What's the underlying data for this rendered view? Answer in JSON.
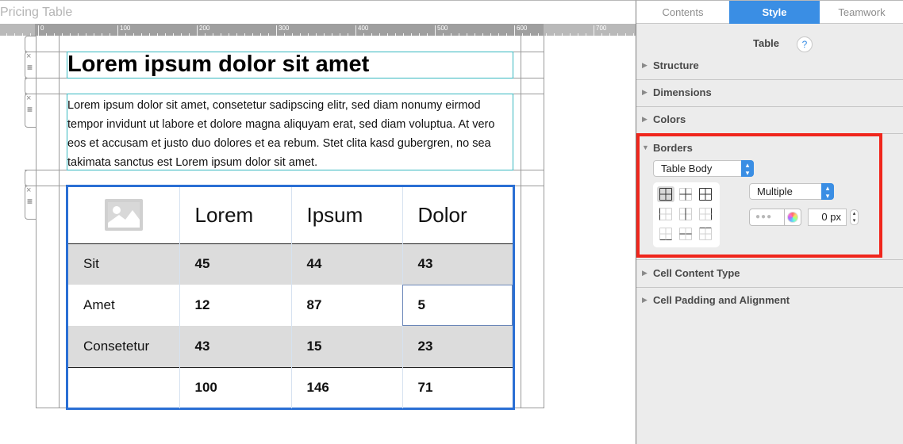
{
  "editor": {
    "page_title": "Pricing Table",
    "ruler": {
      "labels": [
        "0",
        "100",
        "200",
        "300",
        "400",
        "500",
        "600",
        "700"
      ]
    },
    "heading": "Lorem ipsum dolor sit amet",
    "paragraph": "Lorem ipsum dolor sit amet, consetetur sadipscing elitr, sed diam nonumy eirmod tempor invidunt ut labore et dolore magna aliquyam erat, sed diam voluptua. At vero eos et accusam et justo duo dolores et ea rebum. Stet clita kasd gubergren, no sea takimata sanctus est Lorem ipsum dolor sit amet.",
    "row_handle_icons": {
      "close": "×",
      "menu": "≡"
    },
    "table": {
      "header_image_icon": "image-placeholder-icon",
      "columns": [
        "Lorem",
        "Ipsum",
        "Dolor"
      ],
      "rows": [
        {
          "label": "Sit",
          "values": [
            "45",
            "44",
            "43"
          ]
        },
        {
          "label": "Amet",
          "values": [
            "12",
            "87",
            "5"
          ]
        },
        {
          "label": "Consetetur",
          "values": [
            "43",
            "15",
            "23"
          ]
        }
      ],
      "footer": {
        "label": "",
        "values": [
          "100",
          "146",
          "71"
        ]
      }
    }
  },
  "inspector": {
    "tabs": [
      {
        "label": "Contents",
        "active": false
      },
      {
        "label": "Style",
        "active": true
      },
      {
        "label": "Teamwork",
        "active": false
      }
    ],
    "title": "Table",
    "help_label": "?",
    "sections": {
      "structure": "Structure",
      "dimensions": "Dimensions",
      "colors": "Colors",
      "borders": "Borders",
      "cell_content_type": "Cell Content Type",
      "cell_padding": "Cell Padding and Alignment"
    },
    "borders": {
      "target_select": "Table Body",
      "style_select": "Multiple",
      "color_well_placeholder": "●●●",
      "width_value": "0 px",
      "border_options": [
        "all-inner-outer",
        "inner",
        "all",
        "left",
        "vertical-inner",
        "right",
        "bottom",
        "horizontal-inner",
        "top"
      ],
      "selected_option": "all-inner-outer"
    },
    "colors": {
      "accent": "#3a8ee4",
      "highlight": "#f0261c",
      "table_border": "#2a6fd4"
    }
  }
}
